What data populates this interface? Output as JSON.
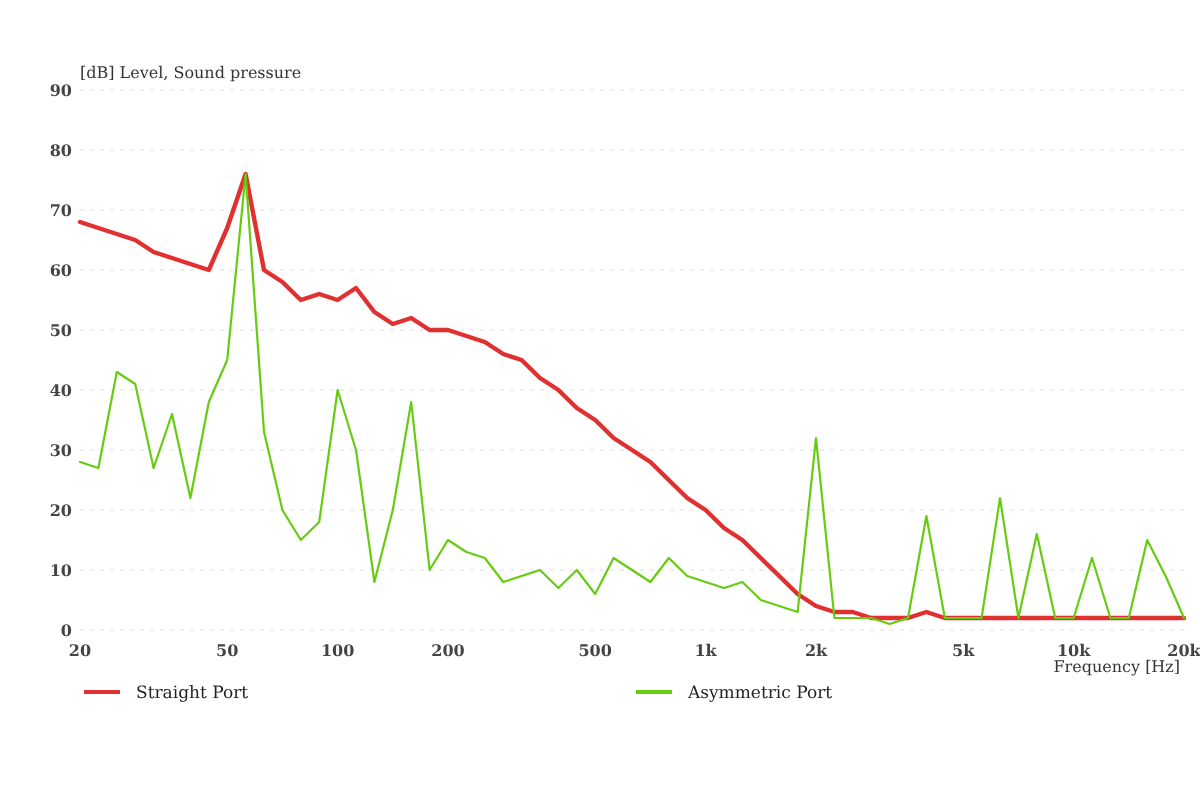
{
  "chart_data": {
    "type": "line",
    "xlabel": "Frequency  [Hz]",
    "ylabel": "[dB]  Level, Sound pressure",
    "categories": [
      "20",
      null,
      null,
      null,
      null,
      null,
      null,
      null,
      "50",
      null,
      null,
      null,
      null,
      null,
      "100",
      null,
      null,
      null,
      null,
      null,
      "200",
      null,
      null,
      null,
      null,
      null,
      null,
      null,
      "500",
      null,
      null,
      null,
      null,
      null,
      "1k",
      null,
      null,
      null,
      null,
      null,
      "2k",
      null,
      null,
      null,
      null,
      null,
      null,
      null,
      "5k",
      null,
      null,
      null,
      null,
      null,
      "10k",
      null,
      null,
      null,
      null,
      null,
      "20k"
    ],
    "series": [
      {
        "name": "Straight Port",
        "color": "#e03030",
        "values": [
          68,
          67,
          66,
          65,
          63,
          62,
          61,
          60,
          67,
          76,
          60,
          58,
          55,
          56,
          55,
          57,
          53,
          51,
          52,
          50,
          50,
          49,
          48,
          46,
          45,
          42,
          40,
          37,
          35,
          32,
          30,
          28,
          25,
          22,
          20,
          17,
          15,
          12,
          9,
          6,
          4,
          3,
          3,
          2,
          2,
          2,
          3,
          2,
          2,
          2,
          2,
          2,
          2,
          2,
          2,
          2,
          2,
          2,
          2,
          2,
          2
        ]
      },
      {
        "name": "Asymmetric Port",
        "color": "#66cc11",
        "values": [
          28,
          27,
          43,
          41,
          27,
          36,
          22,
          38,
          45,
          76,
          33,
          20,
          15,
          18,
          40,
          30,
          8,
          20,
          38,
          10,
          15,
          13,
          12,
          8,
          9,
          10,
          7,
          10,
          6,
          12,
          10,
          8,
          12,
          9,
          8,
          7,
          8,
          5,
          4,
          3,
          32,
          2,
          2,
          2,
          1,
          2,
          19,
          2,
          2,
          2,
          22,
          2,
          16,
          2,
          2,
          12,
          2,
          2,
          15,
          9,
          2
        ]
      }
    ],
    "grid": true,
    "legend": "bottom",
    "ylim": [
      0,
      90
    ],
    "yticks": [
      0,
      10,
      20,
      30,
      40,
      50,
      60,
      70,
      80,
      90
    ]
  }
}
